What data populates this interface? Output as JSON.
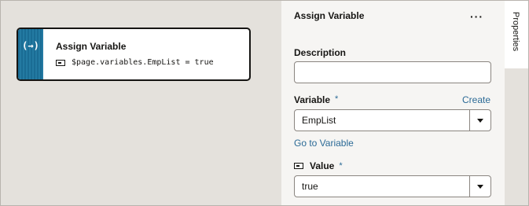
{
  "node": {
    "glyph": "(→)",
    "title": "Assign Variable",
    "expression": "$page.variables.EmpList = true"
  },
  "panel": {
    "title": "Assign Variable",
    "more": "···",
    "description_label": "Description",
    "description_value": "",
    "variable_label": "Variable",
    "variable_required": "*",
    "create_link": "Create",
    "variable_value": "EmpList",
    "goto_link": "Go to Variable",
    "value_label": "Value",
    "value_required": "*",
    "value_value": "true"
  },
  "side_tab": {
    "label": "Properties"
  },
  "colors": {
    "accent": "#2b6a96",
    "node_strip": "#1a6c94"
  },
  "icons": [
    "assign-glyph-icon",
    "variable-icon",
    "more-icon",
    "dropdown-arrow-icon"
  ]
}
